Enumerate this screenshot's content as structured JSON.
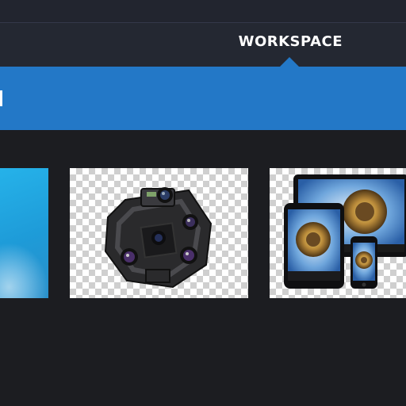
{
  "navigation": {
    "active_tab": "WORKSPACE"
  },
  "cards": [
    {
      "name": "blue-abstract-thumbnail",
      "icon": "abstract-image"
    },
    {
      "name": "vr-camera-rig-thumbnail",
      "icon": "360-camera-rig"
    },
    {
      "name": "devices-panorama-thumbnail",
      "icon": "devices-little-planet"
    }
  ],
  "colors": {
    "background": "#1c1d21",
    "topbar": "#22252f",
    "navbar": "#242832",
    "banner": "#2378c7",
    "tab_text": "#ffffff"
  }
}
